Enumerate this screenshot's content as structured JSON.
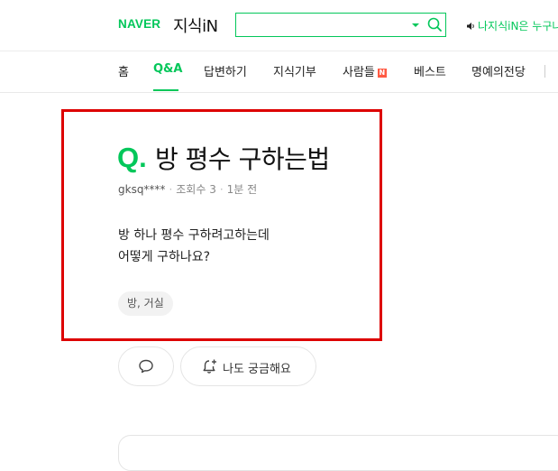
{
  "header": {
    "logo_brand": "NAVER",
    "logo_service": "지식iN",
    "search": {
      "value": "",
      "placeholder": ""
    },
    "notice": "나지식iN은 누구나"
  },
  "nav": {
    "items": [
      {
        "label": "홈"
      },
      {
        "label": "Q&A"
      },
      {
        "label": "답변하기"
      },
      {
        "label": "지식기부"
      },
      {
        "label": "사람들",
        "badge": "N"
      },
      {
        "label": "베스트"
      },
      {
        "label": "명예의전당"
      }
    ],
    "active": "Q&A"
  },
  "question": {
    "mark": "Q.",
    "title": "방 평수 구하는법",
    "author": "gksq****",
    "views": "조회수 3",
    "time": "1분 전",
    "body_line1": "방 하나 평수 구하려고하는데",
    "body_line2": "어떻게 구하나요?",
    "tag": "방, 거실"
  },
  "actions": {
    "curious_label": "나도 궁금해요"
  },
  "colors": {
    "accent": "#03c75a",
    "highlight": "#dd0000",
    "badge": "#ff5a43"
  },
  "icons": [
    "search-icon",
    "chevron-down-icon",
    "speaker-icon",
    "comment-icon",
    "bell-plus-icon"
  ]
}
